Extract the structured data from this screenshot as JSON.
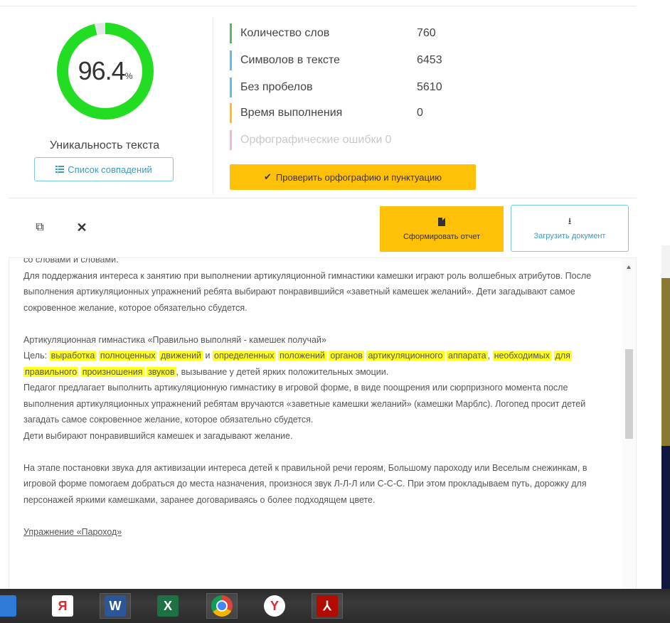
{
  "uniqueness": {
    "value": "96.4",
    "unit": "%",
    "percent": 96.4,
    "label": "Уникальность текста",
    "matches_button": "Список совпадений",
    "ring_color": "#22dd22"
  },
  "stats": [
    {
      "label": "Количество слов",
      "value": "760",
      "color": "#5cb85c"
    },
    {
      "label": "Символов в тексте",
      "value": "6453",
      "color": "#5bc0de"
    },
    {
      "label": "Без пробелов",
      "value": "5610",
      "color": "#5bc0de"
    },
    {
      "label": "Время выполнения",
      "value": "0",
      "color": "#ffc107"
    },
    {
      "label": "Орфографические ошибки",
      "value": "0",
      "color": "#f2b8c6"
    }
  ],
  "spell_button": "Проверить орфографию и пунктуацию",
  "toolbar": {
    "copy_icon": "copy-icon",
    "expand_icon": "expand-icon",
    "report_button": "Сформировать отчет",
    "upload_button": "Загрузить документ"
  },
  "text": {
    "line0": "со словами и словами.",
    "p1": "Для поддержания интереса к занятию при выполнении артикуляционной гимнастики камешки играют роль волшебных атрибутов. После выполнения артикуляционных упражнений ребята выбирают понравившийся «заветный камешек желаний». Дети загадывают самое сокровенное желание, которое обязательно сбудется.",
    "p2_title": "Артикуляционная гимнастика «Правильно выполняй - камешек получай»",
    "p2_goal_prefix": "Цель:",
    "p2_highlights": [
      "выработка",
      "полноценных",
      "движений",
      "и",
      "определенных",
      "положений",
      "органов",
      "артикуляционного",
      "аппарата",
      ",",
      "необходимых",
      "для",
      "правильного",
      "произношения",
      "звуков"
    ],
    "p2_rest": ", вызывание у детей ярких положительных эмоции.",
    "p3": "Педагог предлагает выполнить артикуляционную гимнастику в игровой форме, в виде поощрения или сюрпризного момента после выполнения артикуляционных упражнений ребятам вручаются «заветные камешки желаний» (камешки Марблс). Логопед просит детей загадать самое сокровенное желание, которое обязательно сбудется.",
    "p4": "Дети выбирают понравившийся камешек и загадывают желание.",
    "p5": "На этапе постановки звука для активизации интереса детей к правильной речи героям, Большому пароходу или Веселым снежинкам, в игровой форме помогаем добраться до места назначения, произнося звук Л-Л-Л или С-С-С. При этом прокладываем путь, дорожку для персонажей яркими камешками, заранее договариваясь о более подходящем цвете.",
    "p6": "Упражнение «Пароход»"
  },
  "taskbar": [
    {
      "name": "start-icon",
      "glyph": "",
      "color": "#2d7bd6"
    },
    {
      "name": "yandex-browser-icon",
      "glyph": "Я",
      "color": "#ffffff",
      "text_color": "#e8262a"
    },
    {
      "name": "word-icon",
      "glyph": "W",
      "color": "#2b5797"
    },
    {
      "name": "excel-icon",
      "glyph": "X",
      "color": "#1e7145"
    },
    {
      "name": "chrome-icon",
      "glyph": "",
      "color": "#4285f4"
    },
    {
      "name": "yandex-icon",
      "glyph": "Y",
      "color": "#ffffff",
      "text_color": "#e8262a"
    },
    {
      "name": "acrobat-icon",
      "glyph": "⅄",
      "color": "#b30b00"
    }
  ]
}
